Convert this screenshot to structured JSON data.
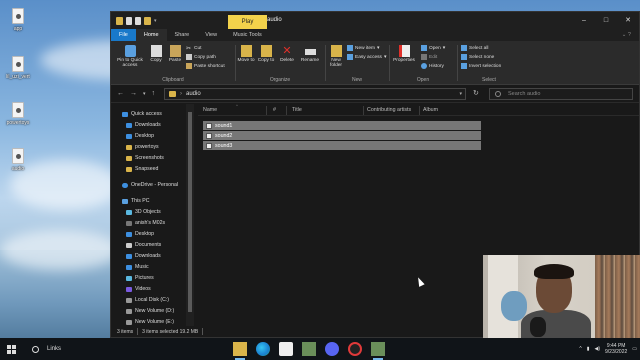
{
  "desktop": {
    "icons": [
      {
        "label": "app",
        "icon": "document-icon"
      },
      {
        "label": "lil_uzi_vert",
        "icon": "image-file-icon"
      },
      {
        "label": "powertoys",
        "icon": "image-file-icon"
      },
      {
        "label": "audio",
        "icon": "audio-file-icon"
      }
    ]
  },
  "window": {
    "title": "audio",
    "context_tab": "Play",
    "controls": [
      "–",
      "□",
      "✕"
    ]
  },
  "ribbon": {
    "tabs": [
      "File",
      "Home",
      "Share",
      "View",
      "Music Tools"
    ],
    "active_tab": "Home",
    "groups": {
      "clipboard": {
        "label": "Clipboard",
        "pin": "Pin to Quick access",
        "copy": "Copy",
        "paste": "Paste",
        "cut": "Cut",
        "copy_path": "Copy path",
        "paste_shortcut": "Paste shortcut"
      },
      "organize": {
        "label": "Organize",
        "move_to": "Move to",
        "copy_to": "Copy to",
        "delete": "Delete",
        "rename": "Rename"
      },
      "new": {
        "label": "New",
        "new_folder": "New folder",
        "new_item": "New item",
        "easy_access": "Easy access"
      },
      "open": {
        "label": "Open",
        "properties": "Properties",
        "open": "Open",
        "edit": "Edit",
        "history": "History"
      },
      "select": {
        "label": "Select",
        "select_all": "Select all",
        "select_none": "Select none",
        "invert_selection": "Invert selection"
      }
    }
  },
  "address_bar": {
    "path": "audio",
    "search_placeholder": "Search audio"
  },
  "nav_pane": {
    "quick_access": "Quick access",
    "quick_items": [
      "Downloads",
      "Desktop",
      "powertoys",
      "Screenshots",
      "Snapseed"
    ],
    "onedrive": "OneDrive - Personal",
    "this_pc": "This PC",
    "pc_items": [
      "3D Objects",
      "anish's M02s",
      "Desktop",
      "Documents",
      "Downloads",
      "Music",
      "Pictures",
      "Videos",
      "Local Disk (C:)",
      "New Volume (D:)",
      "New Volume (E:)"
    ]
  },
  "columns": [
    "Name",
    "#",
    "Title",
    "Contributing artists",
    "Album"
  ],
  "files": [
    "sound1",
    "sound2",
    "sound3"
  ],
  "status": {
    "items": "3 items",
    "selected": "3 items selected  19.2 MB"
  },
  "taskbar": {
    "search_text": "Links",
    "time": "9:44 PM",
    "date": "9/23/2022"
  },
  "colors": {
    "accent": "#1979ca",
    "selection": "#777777",
    "folder": "#d9b44a",
    "play_tab": "#f3d24b"
  }
}
